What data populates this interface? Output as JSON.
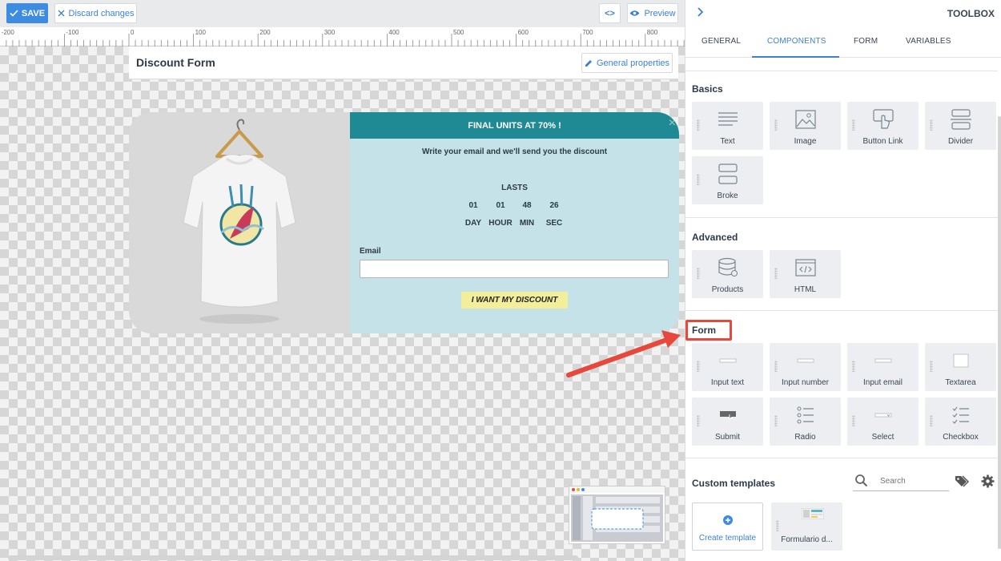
{
  "toolbar": {
    "save_label": "SAVE",
    "discard_label": "Discard changes",
    "code_label": "<>",
    "preview_label": "Preview"
  },
  "ruler": {
    "ticks": [
      "-200",
      "-100",
      "0",
      "100",
      "200",
      "300",
      "400",
      "500",
      "600",
      "700",
      "800"
    ]
  },
  "form": {
    "title": "Discount Form",
    "general_properties_label": "General properties"
  },
  "popup": {
    "banner": "FINAL UNITS AT 70% !",
    "close": "×",
    "subtitle": "Write your email and we'll send you the discount",
    "lasts_label": "LASTS",
    "countdown_values": [
      "01",
      "01",
      "48",
      "26"
    ],
    "countdown_units": [
      "DAY",
      "HOUR",
      "MIN",
      "SEC"
    ],
    "email_label": "Email",
    "email_value": "",
    "button_label": "I WANT MY DISCOUNT"
  },
  "toolbox": {
    "title": "TOOLBOX",
    "tabs": [
      {
        "label": "GENERAL",
        "active": false
      },
      {
        "label": "COMPONENTS",
        "active": true
      },
      {
        "label": "FORM",
        "active": false
      },
      {
        "label": "VARIABLES",
        "active": false
      }
    ],
    "basics_title": "Basics",
    "basics": [
      "Text",
      "Image",
      "Button Link",
      "Divider",
      "Broke"
    ],
    "advanced_title": "Advanced",
    "advanced": [
      "Products",
      "HTML"
    ],
    "form_title": "Form",
    "form_items": [
      "Input text",
      "Input number",
      "Input email",
      "Textarea",
      "Submit",
      "Radio",
      "Select",
      "Checkbox"
    ],
    "custom_title": "Custom templates",
    "search_placeholder": "Search",
    "templates": [
      "Create template",
      "Formulario d..."
    ]
  },
  "colors": {
    "accent": "#3e8ce0",
    "banner": "#1f8a94",
    "popup_bg": "#c5e2e8",
    "cta": "#f2ee9a",
    "highlight": "#e8473c"
  }
}
